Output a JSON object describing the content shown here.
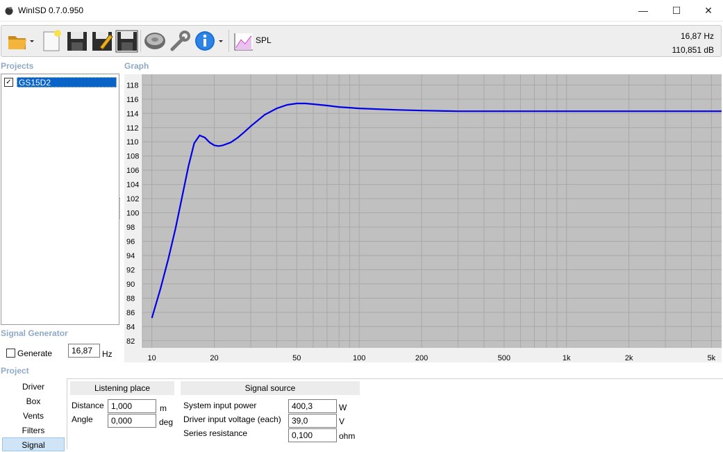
{
  "window": {
    "title": "WinISD 0.7.0.950",
    "minimize": "—",
    "maximize": "☐",
    "close": "✕"
  },
  "toolbar": {
    "icons": [
      "open-folder-icon",
      "new-project-icon",
      "save-icon",
      "save-as-icon",
      "save-all-icon",
      "driver-icon",
      "tools-icon",
      "info-icon",
      "spl-graph-icon"
    ],
    "spl_label": "SPL",
    "readout_freq": "16,87 Hz",
    "readout_db": "110,851 dB"
  },
  "sections": {
    "projects": "Projects",
    "graph": "Graph",
    "signal_generator": "Signal Generator",
    "project": "Project"
  },
  "projects": [
    {
      "name": "GS15D2",
      "checked": true
    }
  ],
  "signal_generator": {
    "generate_label": "Generate",
    "generate_checked": false,
    "frequency": "16,87",
    "unit": "Hz"
  },
  "project_nav": [
    {
      "label": "Driver"
    },
    {
      "label": "Box"
    },
    {
      "label": "Vents"
    },
    {
      "label": "Filters"
    },
    {
      "label": "Signal",
      "selected": true
    }
  ],
  "listening_place": {
    "title": "Listening place",
    "distance_label": "Distance",
    "distance_value": "1,000",
    "distance_unit": "m",
    "angle_label": "Angle",
    "angle_value": "0,000",
    "angle_unit": "deg"
  },
  "signal_source": {
    "title": "Signal source",
    "power_label": "System input power",
    "power_value": "400,3",
    "power_unit": "W",
    "voltage_label": "Driver input voltage (each)",
    "voltage_value": "39,0",
    "voltage_unit": "V",
    "resistance_label": "Series resistance",
    "resistance_value": "0,100",
    "resistance_unit": "ohm"
  },
  "chart_data": {
    "type": "line",
    "title": "",
    "xlabel": "",
    "ylabel": "",
    "x_scale": "log",
    "xlim": [
      9,
      5600
    ],
    "ylim": [
      81,
      119.5
    ],
    "y_ticks": [
      82,
      84,
      86,
      88,
      90,
      92,
      94,
      96,
      98,
      100,
      102,
      104,
      106,
      108,
      110,
      112,
      114,
      116,
      118
    ],
    "x_ticks": [
      10,
      20,
      50,
      100,
      200,
      500,
      1000,
      2000,
      5000
    ],
    "x_tick_labels": [
      "10",
      "20",
      "50",
      "100",
      "200",
      "500",
      "1k",
      "2k",
      "5k"
    ],
    "grid": true,
    "colors": {
      "background": "#c0c0c0",
      "grid": "#a8a8a8",
      "line": "#0000e6"
    },
    "series": [
      {
        "x": [
          10,
          11,
          12,
          13,
          14,
          15,
          16,
          17,
          18,
          19,
          20,
          21,
          22,
          24,
          26,
          28,
          30,
          35,
          40,
          45,
          50,
          55,
          60,
          70,
          80,
          100,
          150,
          200,
          300,
          500,
          1000,
          2000,
          5000,
          5600
        ],
        "y": [
          85.2,
          89.3,
          93.5,
          97.8,
          102.3,
          106.5,
          109.8,
          110.9,
          110.6,
          109.9,
          109.5,
          109.4,
          109.5,
          109.9,
          110.6,
          111.4,
          112.2,
          113.8,
          114.7,
          115.2,
          115.4,
          115.4,
          115.3,
          115.1,
          114.9,
          114.7,
          114.5,
          114.4,
          114.3,
          114.3,
          114.3,
          114.3,
          114.3,
          114.3
        ]
      }
    ]
  }
}
